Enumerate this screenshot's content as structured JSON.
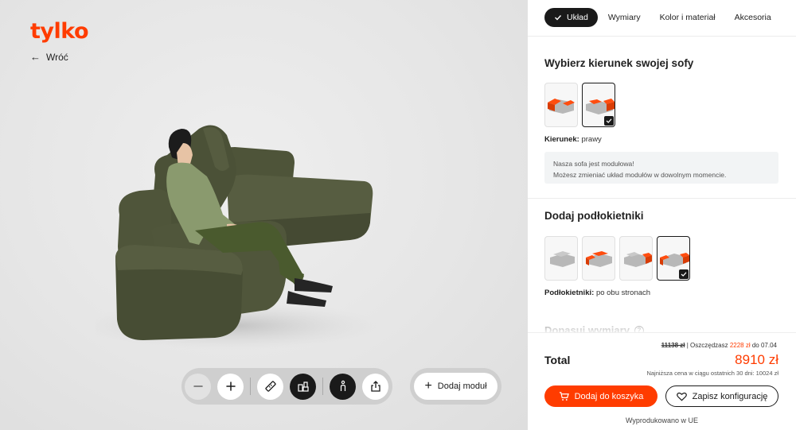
{
  "brand": {
    "logo": "tylko",
    "accent": "#ff3c00"
  },
  "nav": {
    "back_label": "Wróć"
  },
  "tabs": [
    {
      "label": "Układ",
      "active": true
    },
    {
      "label": "Wymiary",
      "active": false
    },
    {
      "label": "Kolor i materiał",
      "active": false
    },
    {
      "label": "Akcesoria",
      "active": false
    }
  ],
  "direction": {
    "title": "Wybierz kierunek swojej sofy",
    "value_label": "Kierunek:",
    "value": "prawy",
    "selected_index": 1,
    "options": [
      "direction-left",
      "direction-right"
    ]
  },
  "info": {
    "line1": "Nasza sofa jest modułowa!",
    "line2": "Możesz zmieniać układ modułów w dowolnym momencie."
  },
  "armrests": {
    "title": "Dodaj podłokietniki",
    "value_label": "Podłokietniki:",
    "value": "po obu stronach",
    "selected_index": 3,
    "options": [
      "armrest-none",
      "armrest-left",
      "armrest-right",
      "armrest-both"
    ]
  },
  "dimensions_teaser": {
    "title": "Dopasuj wymiary"
  },
  "pricing": {
    "total_label": "Total",
    "old_price": "11138 zł",
    "savings_prefix": "| Oszczędzasz",
    "savings_amount": "2228 zł",
    "savings_suffix": "do 07.04",
    "price": "8910 zł",
    "lowest_price_note": "Najniższa cena w ciągu ostatnich 30 dni: 10024 zł"
  },
  "actions": {
    "add_to_cart": "Dodaj do koszyka",
    "save_config": "Zapisz konfigurację",
    "add_module": "Dodaj moduł"
  },
  "footer": {
    "made_in": "Wyprodukowano w UE"
  },
  "toolbar": {
    "buttons": [
      "zoom-out-icon",
      "zoom-in-icon",
      "ruler-icon",
      "room-view-icon",
      "person-icon",
      "share-icon"
    ]
  },
  "colors": {
    "sofa": "#4d5338",
    "primary_dark": "#1a1a1a",
    "info_bg": "#f2f4f5"
  }
}
